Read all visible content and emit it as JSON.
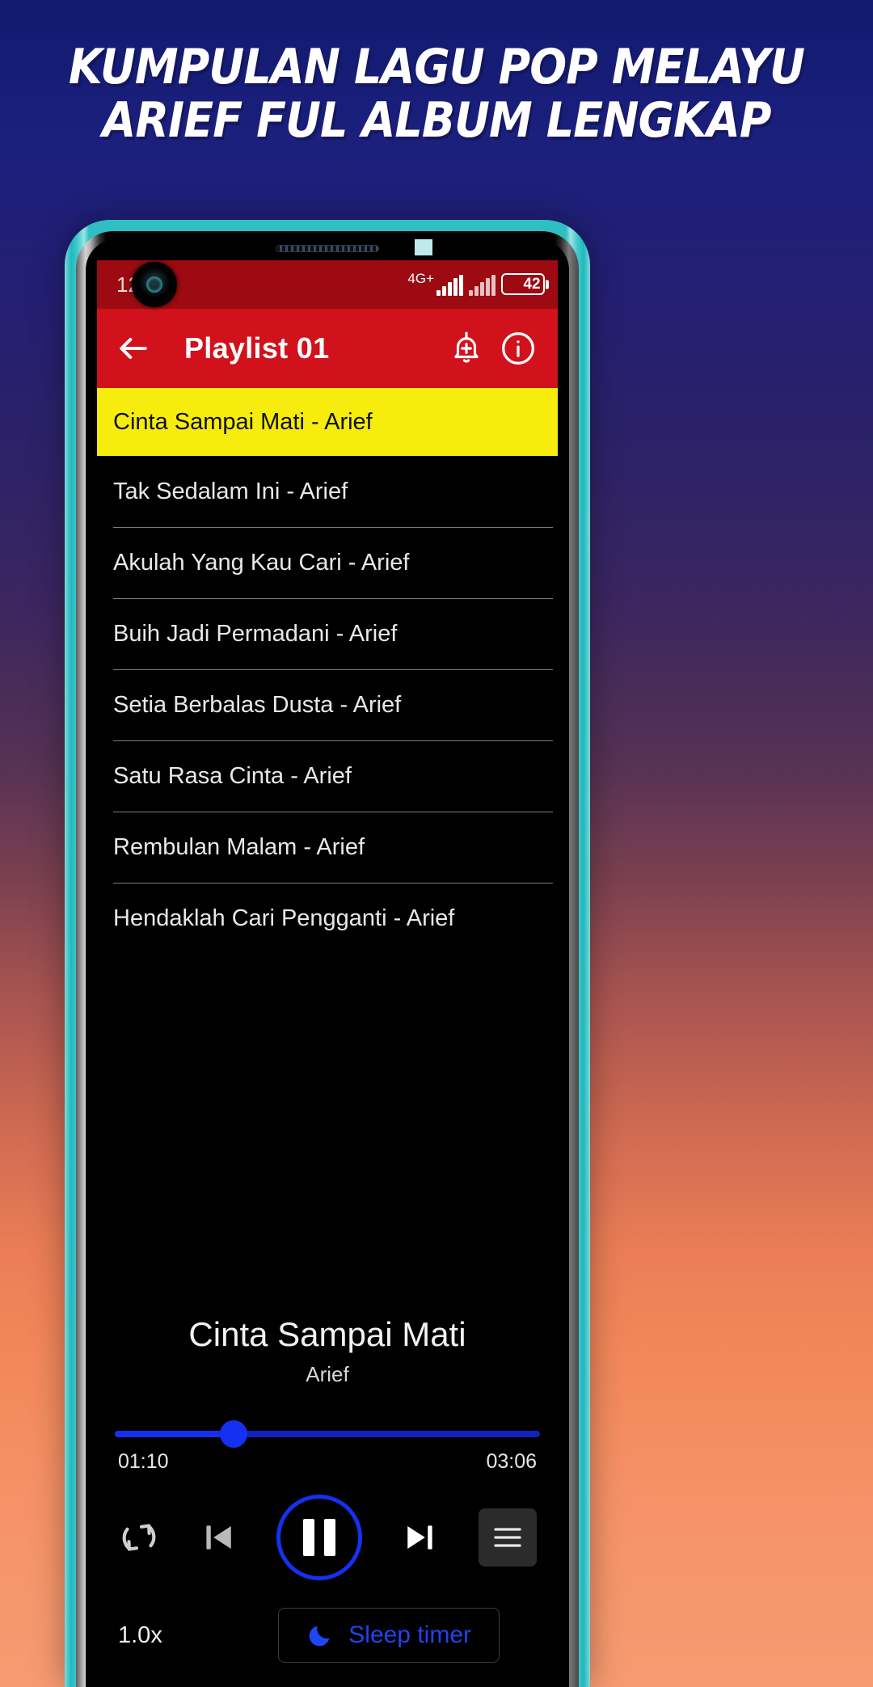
{
  "promo": {
    "headline": "KUMPULAN LAGU POP MELAYU\nARIEF FUL ALBUM LENGKAP",
    "bg_top_color": "#101a6e",
    "bg_bottom_color": "#f79b72",
    "phone_frame_color": "#2fbfc2"
  },
  "statusbar": {
    "clock": "12",
    "network_label": "4G+",
    "battery_level": "42",
    "accent_color": "#9d0a11"
  },
  "toolbar": {
    "back_label": "←",
    "title": "Playlist 01",
    "alarm_icon_name": "bell-plus-icon",
    "info_icon_name": "info-circle-icon",
    "background_color": "#d1111b"
  },
  "songlist": {
    "highlight_color": "#f6ec0d",
    "items": [
      {
        "title": "Cinta Sampai Mati - Arief",
        "active": true
      },
      {
        "title": "Tak Sedalam Ini - Arief",
        "active": false
      },
      {
        "title": "Akulah Yang Kau Cari - Arief",
        "active": false
      },
      {
        "title": "Buih Jadi Permadani - Arief",
        "active": false
      },
      {
        "title": "Setia Berbalas Dusta - Arief",
        "active": false
      },
      {
        "title": "Satu Rasa Cinta - Arief",
        "active": false
      },
      {
        "title": "Rembulan Malam - Arief",
        "active": false
      },
      {
        "title": "Hendaklah Cari Pengganti - Arief",
        "active": false
      }
    ]
  },
  "nowplaying": {
    "title": "Cinta Sampai Mati",
    "artist": "Arief",
    "elapsed": "01:10",
    "duration": "03:06",
    "progress_percent": 28,
    "accent_color": "#1530f0"
  },
  "controls": {
    "repeat_icon_name": "repeat-icon",
    "previous_icon_name": "skip-previous-icon",
    "play_pause_icon_name": "pause-icon",
    "next_icon_name": "skip-next-icon",
    "queue_icon_name": "queue-list-icon"
  },
  "bottombar": {
    "speed": "1.0x",
    "sleep_timer_label": "Sleep timer",
    "moon_icon_name": "moon-icon"
  }
}
